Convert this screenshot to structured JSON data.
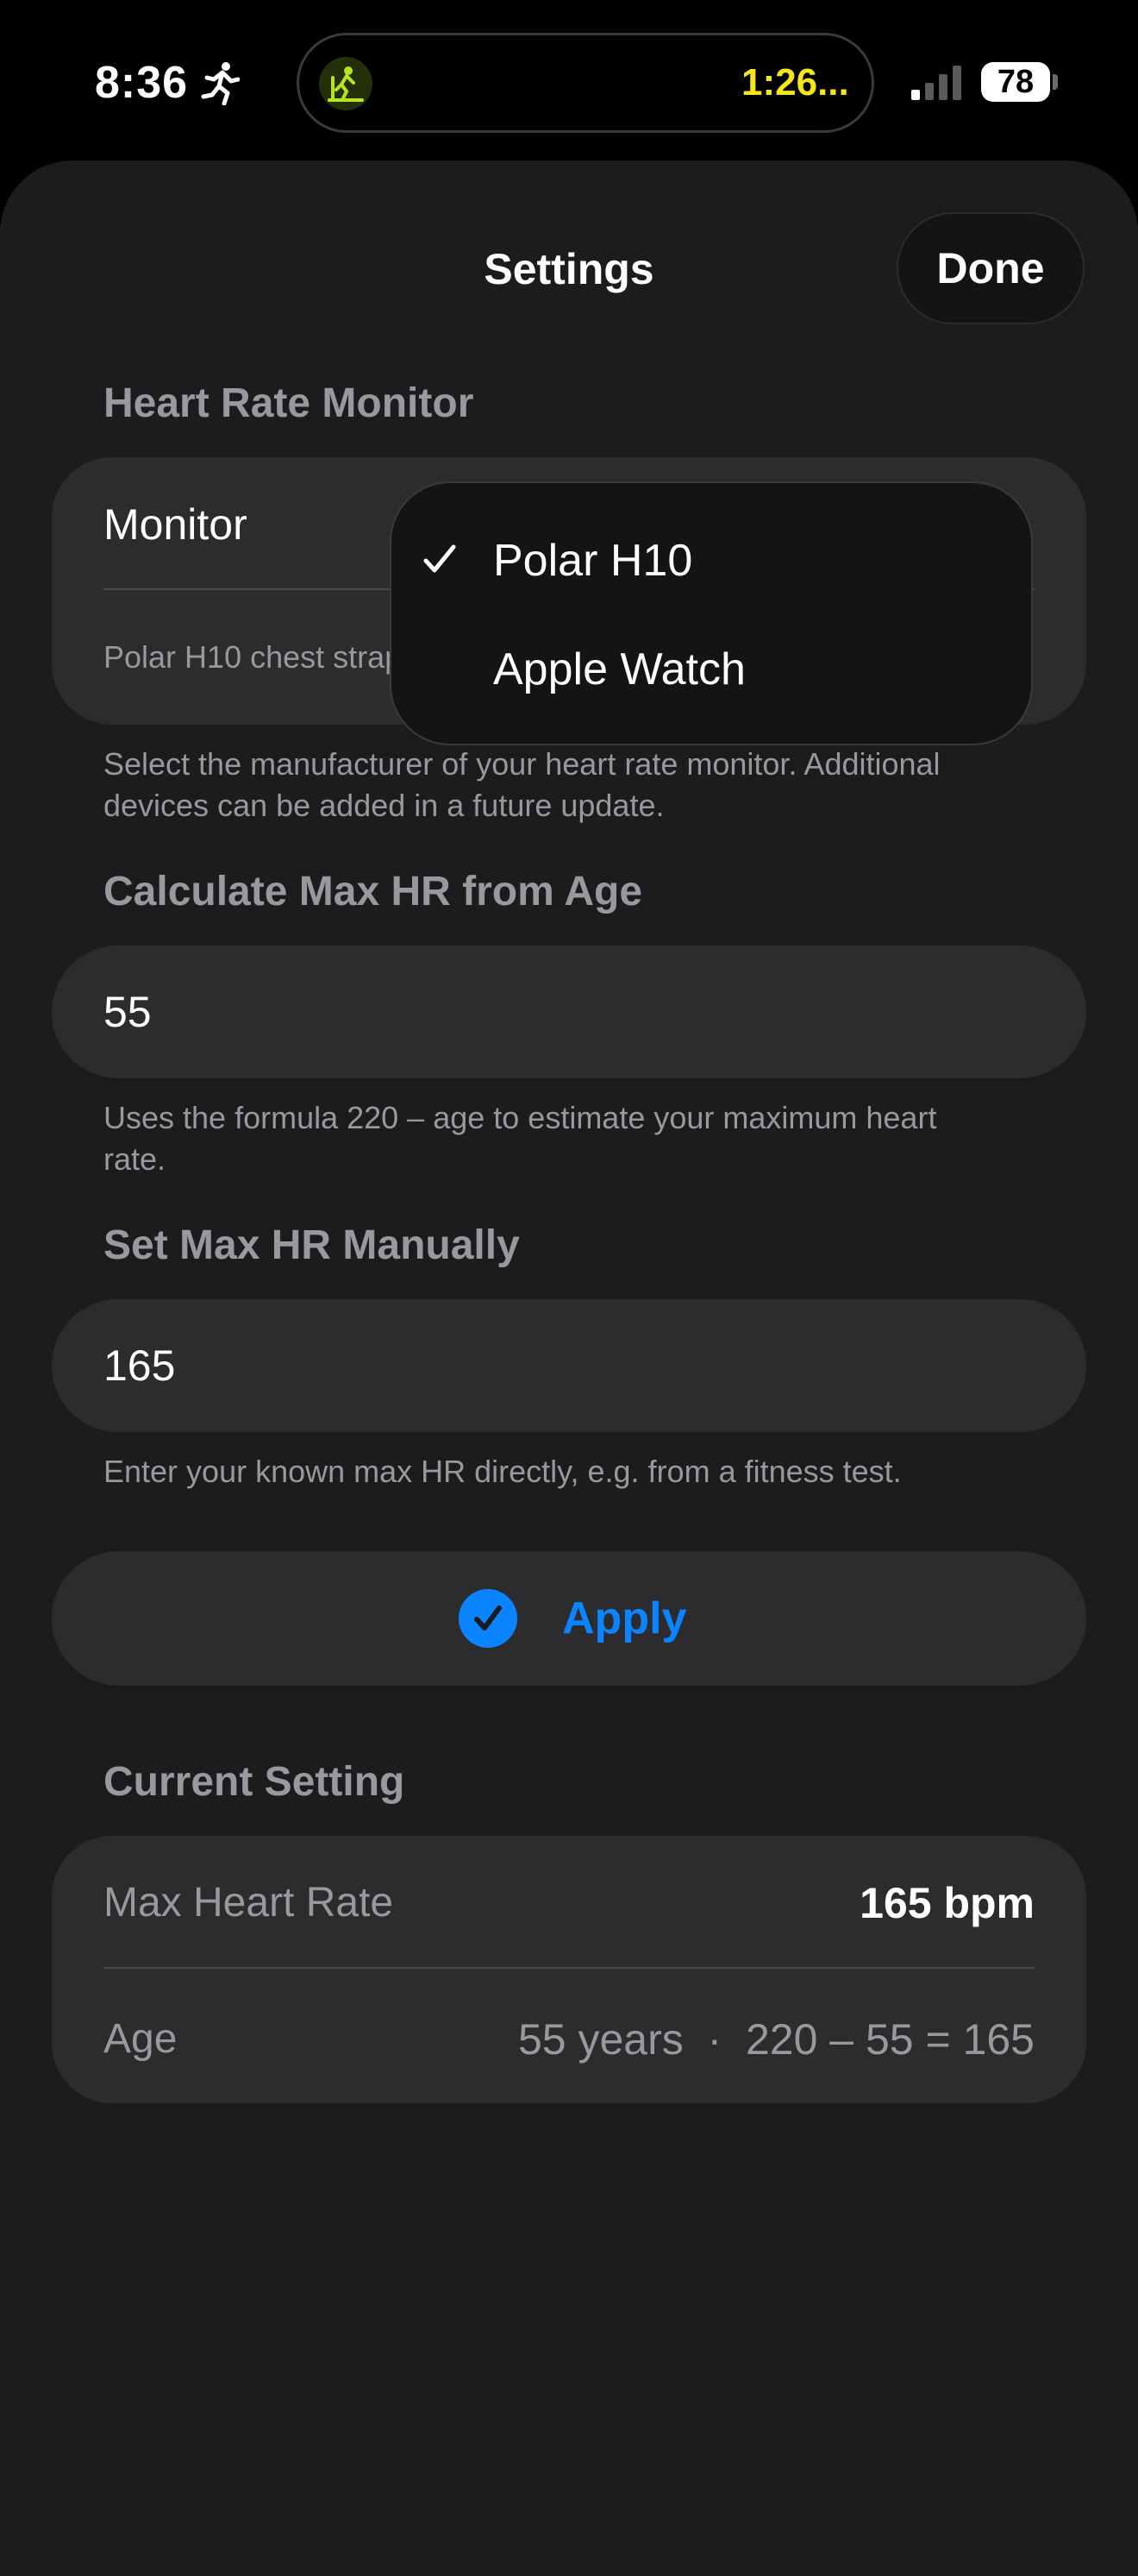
{
  "status_bar": {
    "time": "8:36",
    "island_timer": "1:26...",
    "battery": "78",
    "icons": [
      "running-figure-icon",
      "treadmill-icon",
      "signal-bars-icon",
      "battery-icon"
    ]
  },
  "nav": {
    "title": "Settings",
    "done_label": "Done"
  },
  "heart_rate_monitor": {
    "header": "Heart Rate Monitor",
    "field_label": "Monitor",
    "subtitle": "Polar H10 chest strap",
    "footnote": "Select the manufacturer of your heart rate monitor. Additional devices can be added in a future update.",
    "dropdown": {
      "selected": "Polar H10",
      "options": [
        "Polar H10",
        "Apple Watch"
      ]
    }
  },
  "age_section": {
    "header": "Calculate Max HR from Age",
    "value": "55",
    "footnote": "Uses the formula 220 – age to estimate your maximum heart rate."
  },
  "manual_section": {
    "header": "Set Max HR Manually",
    "value": "165",
    "footnote": "Enter your known max HR directly, e.g. from a fitness test."
  },
  "apply": {
    "label": "Apply"
  },
  "current_setting": {
    "header": "Current Setting",
    "rows": [
      {
        "label": "Max Heart Rate",
        "value": "165 bpm"
      },
      {
        "label": "Age",
        "value": "55 years  ·  220 – 55 = 165"
      }
    ]
  },
  "colors": {
    "accent": "#0a84ff",
    "sheet_bg": "#1c1c1e",
    "card_bg": "#2c2c2e",
    "secondary_text": "#98989d",
    "timer_yellow": "#f5e61a"
  }
}
